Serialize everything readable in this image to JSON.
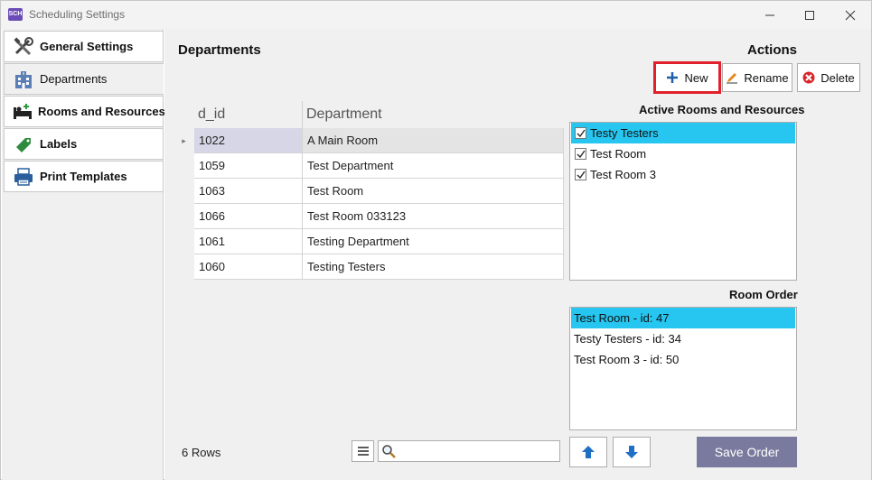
{
  "window": {
    "title": "Scheduling Settings",
    "app_icon_text": "SCH"
  },
  "sidebar": {
    "items": [
      {
        "label": "General Settings",
        "icon": "tools-icon"
      },
      {
        "label": "Departments",
        "icon": "building-icon"
      },
      {
        "label": "Rooms and Resources",
        "icon": "bed-icon"
      },
      {
        "label": "Labels",
        "icon": "tag-icon"
      },
      {
        "label": "Print Templates",
        "icon": "printer-icon"
      }
    ],
    "active_index": 1
  },
  "main": {
    "title": "Departments",
    "actions_title": "Actions",
    "buttons": {
      "new_label": "New",
      "rename_label": "Rename",
      "delete_label": "Delete"
    }
  },
  "grid": {
    "columns": [
      "d_id",
      "Department"
    ],
    "rows": [
      {
        "d_id": "1022",
        "department": "A Main Room"
      },
      {
        "d_id": "1059",
        "department": "Test Department"
      },
      {
        "d_id": "1063",
        "department": "Test Room"
      },
      {
        "d_id": "1066",
        "department": "Test Room 033123"
      },
      {
        "d_id": "1061",
        "department": "Testing Department"
      },
      {
        "d_id": "1060",
        "department": "Testing Testers"
      }
    ],
    "selected_row": 0,
    "row_count_text": "6 Rows",
    "search_placeholder": ""
  },
  "active_rooms": {
    "title": "Active Rooms and Resources",
    "items": [
      {
        "label": "Testy Testers",
        "checked": true
      },
      {
        "label": "Test Room",
        "checked": true
      },
      {
        "label": "Test Room 3",
        "checked": true
      }
    ],
    "selected_index": 0
  },
  "room_order": {
    "title": "Room Order",
    "items": [
      "Test Room - id: 47",
      "Testy Testers - id: 34",
      "Test Room 3 - id: 50"
    ],
    "selected_index": 0,
    "save_label": "Save Order"
  },
  "colors": {
    "selection": "#26c6f0",
    "highlight_outline": "#e0202a",
    "save_button": "#7a7a9e",
    "arrow_blue": "#1f6fc5"
  }
}
